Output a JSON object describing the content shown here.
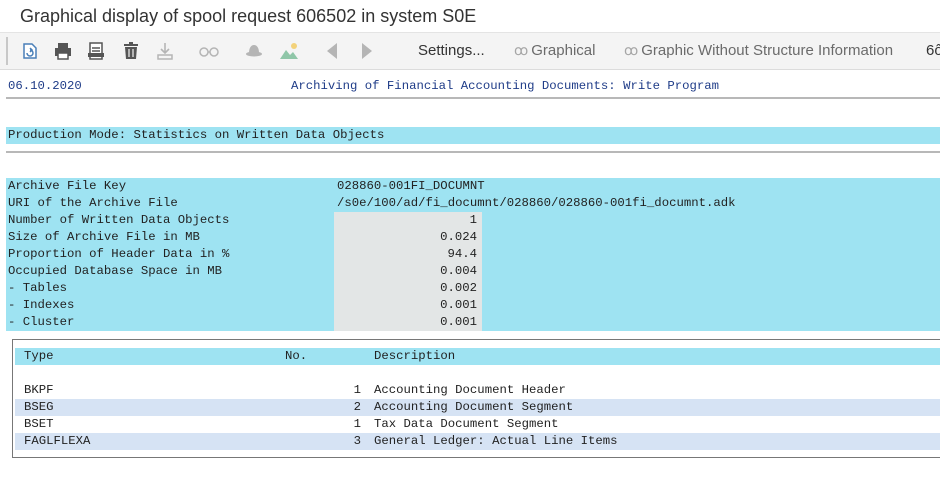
{
  "window": {
    "title": "Graphical display of spool request 606502 in system S0E"
  },
  "toolbar": {
    "icons": [
      "refresh-icon",
      "print-icon",
      "print-preview-icon",
      "delete-icon",
      "download-icon",
      "display-icon",
      "hat-icon",
      "image-icon",
      "arrow-left-icon",
      "arrow-right-icon"
    ],
    "settings_label": "Settings...",
    "graphical_label": "Graphical",
    "graphic_no_struct_label": "Graphic Without Structure Information",
    "overflow_glyph": "6ô"
  },
  "report": {
    "date": "06.10.2020",
    "title": "Archiving of Financial Accounting Documents: Write Program",
    "section_title": "Production Mode: Statistics on Written Data Objects",
    "stats": [
      {
        "label": "Archive File Key",
        "value": "028860-001FI_DOCUMNT"
      },
      {
        "label": "URI of the Archive File",
        "value": "/s0e/100/ad/fi_documnt/028860/028860-001fi_documnt.adk"
      },
      {
        "label": "Number of Written Data Objects",
        "value": "1"
      },
      {
        "label": "Size of Archive File in MB",
        "value": "0.024"
      },
      {
        "label": "Proportion of Header Data in %",
        "value": "94.4"
      },
      {
        "label": "Occupied Database Space in MB",
        "value": "0.004"
      },
      {
        "label": "- Tables",
        "value": "0.002"
      },
      {
        "label": "- Indexes",
        "value": "0.001"
      },
      {
        "label": "- Cluster",
        "value": "0.001"
      }
    ]
  },
  "table": {
    "headers": {
      "type": "Type",
      "no": "No.",
      "description": "Description"
    },
    "rows": [
      {
        "type": "BKPF",
        "no": "1",
        "description": "Accounting Document Header"
      },
      {
        "type": "BSEG",
        "no": "2",
        "description": "Accounting Document Segment"
      },
      {
        "type": "BSET",
        "no": "1",
        "description": "Tax Data Document Segment"
      },
      {
        "type": "FAGLFLEXA",
        "no": "3",
        "description": "General Ledger: Actual Line Items"
      }
    ]
  },
  "colors": {
    "band": "#9ee3f2",
    "value_cell": "#e3e6e6",
    "alt_row": "#d6e3f4",
    "header_text": "#1f3c88"
  }
}
